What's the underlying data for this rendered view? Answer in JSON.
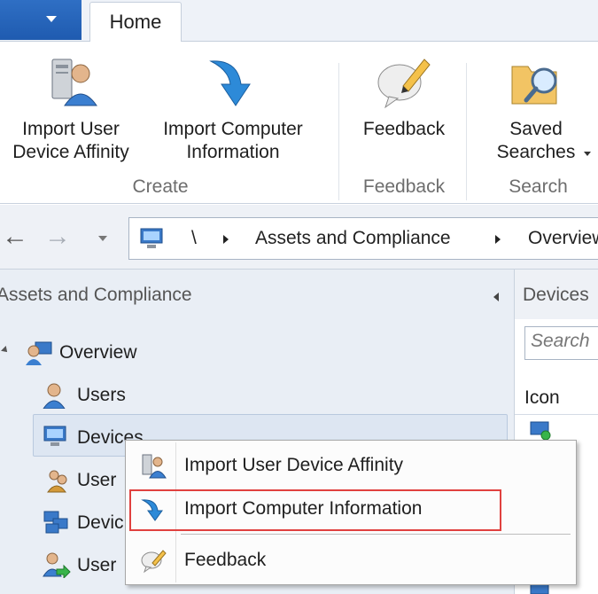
{
  "tabs": {
    "home": "Home"
  },
  "ribbon": {
    "import_user_device_affinity": "Import User\nDevice Affinity",
    "import_computer_information": "Import Computer\nInformation",
    "feedback": "Feedback",
    "saved_searches": "Saved\nSearches",
    "groups": {
      "create": "Create",
      "feedback": "Feedback",
      "search": "Search"
    }
  },
  "address": {
    "root": "\\",
    "crumb1": "Assets and Compliance",
    "crumb2": "Overview"
  },
  "nav": {
    "title": "Assets and Compliance",
    "overview": "Overview",
    "users": "Users",
    "devices": "Devices",
    "user_collections_partial": "User",
    "device_collections_partial": "Devic",
    "user_state_partial": "User"
  },
  "right_pane": {
    "title": "Devices",
    "search_placeholder": "Search",
    "column_icon": "Icon"
  },
  "context_menu": {
    "items": [
      {
        "label": "Import User Device Affinity",
        "icon": "user-device-affinity-icon"
      },
      {
        "label": "Import Computer Information",
        "icon": "import-arrow-icon"
      },
      {
        "label": "Feedback",
        "icon": "feedback-bubble-icon"
      }
    ]
  },
  "colors": {
    "accent": "#1f5bb0",
    "highlight_box": "#e0413f",
    "selection": "#dde6f2"
  }
}
